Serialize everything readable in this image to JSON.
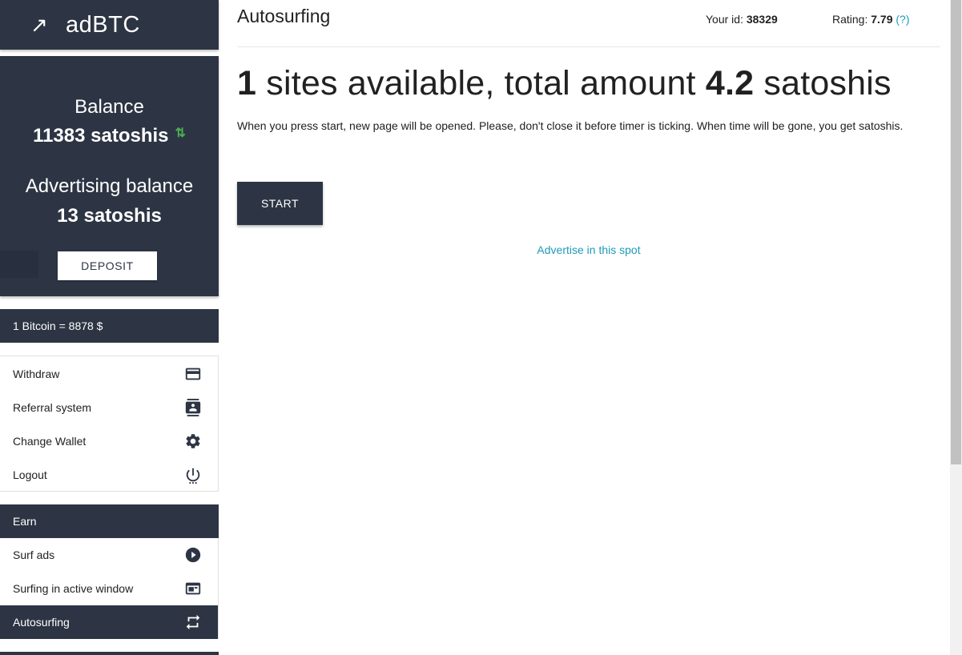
{
  "logo": {
    "arrow": "↗",
    "text": "adBTC"
  },
  "balance": {
    "title": "Balance",
    "value": "11383 satoshis",
    "arrows": "⇅",
    "adv_title": "Advertising balance",
    "adv_value": "13 satoshis",
    "deposit_label": "DEPOSIT"
  },
  "rate": {
    "text": "1 Bitcoin = 8878 $"
  },
  "account_menu": [
    {
      "label": "Withdraw",
      "icon": "credit-card-icon"
    },
    {
      "label": "Referral system",
      "icon": "contacts-icon"
    },
    {
      "label": "Change Wallet",
      "icon": "gear-icon"
    },
    {
      "label": "Logout",
      "icon": "power-icon"
    }
  ],
  "earn": {
    "title": "Earn",
    "items": [
      {
        "label": "Surf ads",
        "icon": "play-circle-icon"
      },
      {
        "label": "Surfing in active window",
        "icon": "window-icon"
      },
      {
        "label": "Autosurfing",
        "icon": "repeat-icon",
        "active": true
      }
    ]
  },
  "header": {
    "title": "Autosurfing",
    "user_id_label": "Your id: ",
    "user_id": "38329",
    "rating_label": "Rating: ",
    "rating": "7.79",
    "rating_help": "(?)"
  },
  "main": {
    "sites_count": "1",
    "headline_middle": " sites available, total amount ",
    "amount": "4.2",
    "headline_end": " satoshis",
    "description": "When you press start, new page will be opened. Please, don't close it before timer is ticking. When time will be gone, you get satoshis.",
    "start_label": "START",
    "advertise_link": "Advertise in this spot"
  }
}
